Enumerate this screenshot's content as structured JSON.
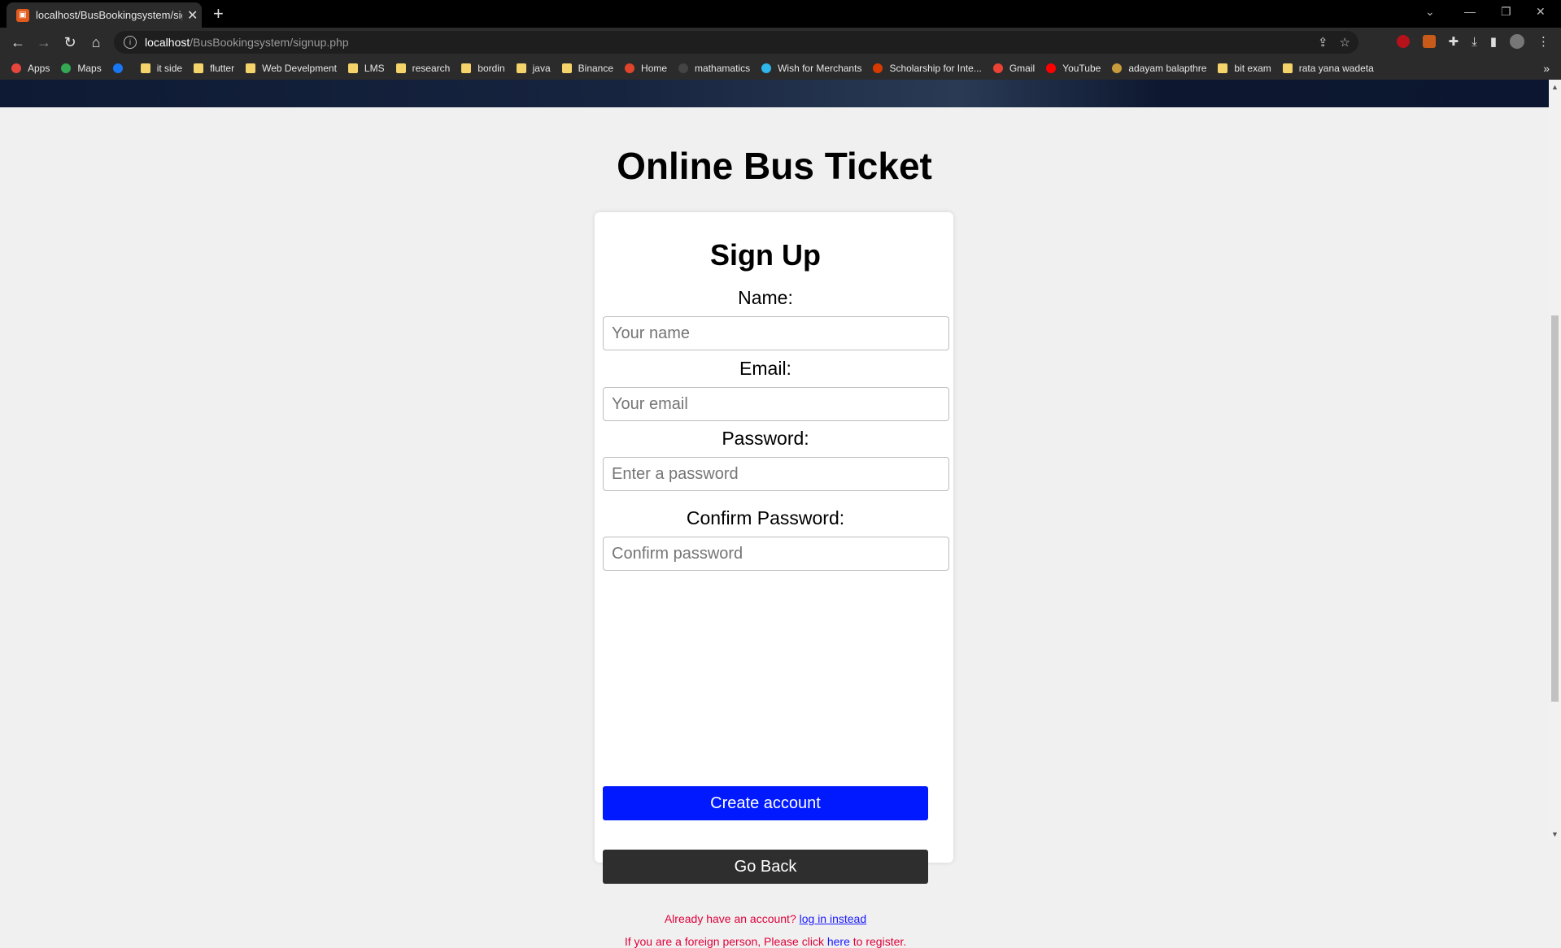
{
  "browser": {
    "tab_title": "localhost/BusBookingsystem/sig",
    "url_host": "localhost",
    "url_path": "/BusBookingsystem/signup.php",
    "bookmarks": [
      {
        "label": "Apps",
        "icon": "apps-grid-icon"
      },
      {
        "label": "Maps",
        "icon": "maps-icon"
      },
      {
        "label": "",
        "icon": "facebook-icon"
      },
      {
        "label": "it side",
        "icon": "folder-icon"
      },
      {
        "label": "flutter",
        "icon": "folder-icon"
      },
      {
        "label": "Web Develpment",
        "icon": "folder-icon"
      },
      {
        "label": "LMS",
        "icon": "folder-icon"
      },
      {
        "label": "research",
        "icon": "folder-icon"
      },
      {
        "label": "bordin",
        "icon": "folder-icon"
      },
      {
        "label": "java",
        "icon": "folder-icon"
      },
      {
        "label": "Binance",
        "icon": "folder-icon"
      },
      {
        "label": "Home",
        "icon": "home-circle-icon"
      },
      {
        "label": "mathamatics",
        "icon": "github-icon"
      },
      {
        "label": "Wish for Merchants",
        "icon": "wish-icon"
      },
      {
        "label": "Scholarship for Inte...",
        "icon": "365-icon"
      },
      {
        "label": "Gmail",
        "icon": "gmail-icon"
      },
      {
        "label": "YouTube",
        "icon": "youtube-icon"
      },
      {
        "label": "adayam balapthre",
        "icon": "coin-icon"
      },
      {
        "label": "bit exam",
        "icon": "folder-icon"
      },
      {
        "label": "rata yana wadeta",
        "icon": "folder-icon"
      }
    ],
    "more_symbol": "»"
  },
  "page": {
    "title": "Online Bus Ticket",
    "form": {
      "heading": "Sign Up",
      "name_label": "Name:",
      "name_placeholder": "Your name",
      "email_label": "Email:",
      "email_placeholder": "Your email",
      "password_label": "Password:",
      "password_placeholder": "Enter a password",
      "confirm_label": "Confirm Password:",
      "confirm_placeholder": "Confirm password",
      "create_button": "Create account",
      "back_button": "Go Back",
      "login_prompt": "Already have an account?",
      "login_link": "log in instead",
      "foreign_prefix": "If you are a foreign person, Please click",
      "foreign_link": "here",
      "foreign_suffix": "to register."
    }
  },
  "colors": {
    "create_button": "#0019ff",
    "back_button": "#2e2e2e",
    "note_text": "#e0003a",
    "link": "#1a1aff"
  }
}
